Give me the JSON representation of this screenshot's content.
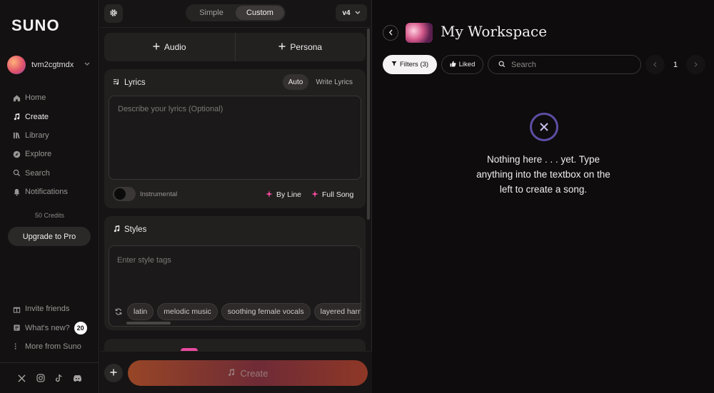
{
  "sidebar": {
    "logo": "SUNO",
    "username": "tvm2cgtmdx",
    "nav": [
      {
        "label": "Home"
      },
      {
        "label": "Create"
      },
      {
        "label": "Library"
      },
      {
        "label": "Explore"
      },
      {
        "label": "Search"
      },
      {
        "label": "Notifications"
      }
    ],
    "credits": "50 Credits",
    "upgrade_label": "Upgrade to Pro",
    "bottom": [
      {
        "label": "Invite friends"
      },
      {
        "label": "What's new?",
        "badge": "20"
      },
      {
        "label": "More from Suno"
      }
    ],
    "socials": [
      "x-icon",
      "instagram-icon",
      "tiktok-icon",
      "discord-icon"
    ]
  },
  "create": {
    "modes": [
      "Simple",
      "Custom"
    ],
    "active_mode": "Custom",
    "version": "v4",
    "add_audio": "Audio",
    "add_persona": "Persona",
    "lyrics": {
      "title": "Lyrics",
      "modes": [
        "Auto",
        "Write Lyrics"
      ],
      "placeholder": "Describe your lyrics (Optional)",
      "instrumental": "Instrumental",
      "by_line": "By Line",
      "full_song": "Full Song"
    },
    "styles": {
      "title": "Styles",
      "placeholder": "Enter style tags",
      "tags": [
        "latin",
        "melodic music",
        "soothing female vocals",
        "layered harmonies"
      ]
    },
    "create_label": "Create"
  },
  "workspace": {
    "title": "My Workspace",
    "filters_label": "Filters (3)",
    "liked_label": "Liked",
    "search_placeholder": "Search",
    "page": "1",
    "empty_message": "Nothing here . . . yet. Type anything into the textbox on the left to create a song."
  },
  "colors": {
    "accent_pink": "#ff4fa3",
    "create_gradient_start": "#c2562c",
    "empty_icon_ring": "#5e4ea6"
  }
}
